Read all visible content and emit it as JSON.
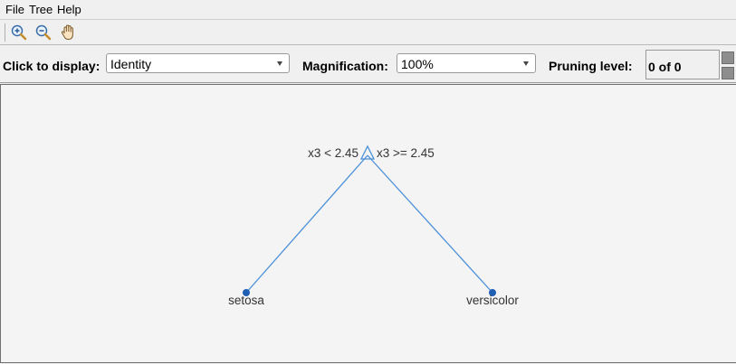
{
  "menu": {
    "file": "File",
    "tree": "Tree",
    "help": "Help"
  },
  "toolbar": {
    "zoom_in": "zoom-in-icon",
    "zoom_out": "zoom-out-icon",
    "pan": "pan-hand-icon"
  },
  "controls": {
    "display_label": "Click to display:",
    "display_value": "Identity",
    "magnification_label": "Magnification:",
    "magnification_value": "100%",
    "pruning_label": "Pruning level:",
    "pruning_value": "0 of 0"
  },
  "tree": {
    "root_left_rule": "x3 < 2.45",
    "root_right_rule": "x3 >= 2.45",
    "leaf_left": "setosa",
    "leaf_right": "versicolor",
    "edge_color": "#4a90d9",
    "node_color": "#1f5fb5"
  }
}
